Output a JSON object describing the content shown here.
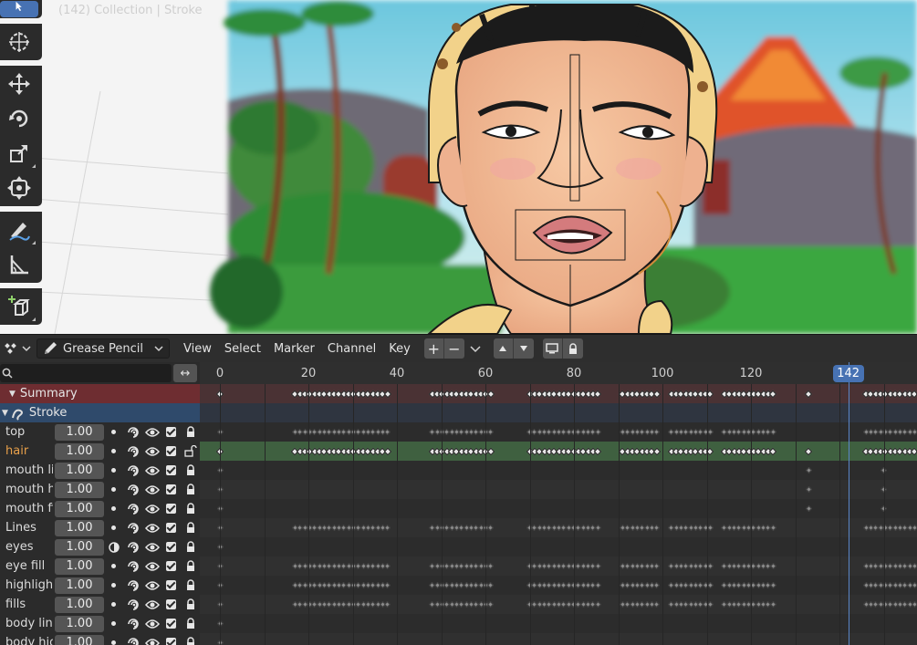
{
  "viewport": {
    "info": "(142) Collection | Stroke",
    "tools": [
      "select-box-icon",
      "cursor-icon",
      "move-icon",
      "rotate-icon",
      "scale-icon",
      "transform-icon",
      "annotate-icon",
      "measure-icon",
      "add-cube-icon"
    ]
  },
  "header": {
    "editor_type_icon": "dopesheet-icon",
    "mode": "Grease Pencil",
    "menus": [
      "View",
      "Select",
      "Marker",
      "Channel",
      "Key"
    ],
    "buttons": [
      "add-layer-icon",
      "remove-layer-icon",
      "chevron-down-icon",
      "move-up-icon",
      "move-down-icon",
      "monitor-icon",
      "lock-icon"
    ]
  },
  "channels": {
    "search_placeholder": "",
    "summary_label": "Summary",
    "object_label": "Stroke",
    "layers": [
      {
        "name": "top",
        "opacity": "1.00",
        "locked": true,
        "active": false
      },
      {
        "name": "hair",
        "opacity": "1.00",
        "locked": false,
        "active": true
      },
      {
        "name": "mouth lin",
        "opacity": "1.00",
        "locked": true,
        "active": false
      },
      {
        "name": "mouth hi",
        "opacity": "1.00",
        "locked": true,
        "active": false
      },
      {
        "name": "mouth fill",
        "opacity": "1.00",
        "locked": true,
        "active": false
      },
      {
        "name": "Lines",
        "opacity": "1.00",
        "locked": true,
        "active": false
      },
      {
        "name": "eyes",
        "opacity": "1.00",
        "locked": true,
        "active": false
      },
      {
        "name": "eye fill",
        "opacity": "1.00",
        "locked": true,
        "active": false
      },
      {
        "name": "highlight",
        "opacity": "1.00",
        "locked": true,
        "active": false
      },
      {
        "name": "fills",
        "opacity": "1.00",
        "locked": true,
        "active": false
      },
      {
        "name": "body line",
        "opacity": "1.00",
        "locked": true,
        "active": false
      },
      {
        "name": "body hig",
        "opacity": "1.00",
        "locked": true,
        "active": false
      }
    ]
  },
  "timeline": {
    "frame_labels": [
      "0",
      "20",
      "40",
      "60",
      "80",
      "100",
      "120"
    ],
    "current_frame": "142",
    "colors": {
      "summary": "#6e2d31",
      "object": "#2f4a6b",
      "active_layer": "#2f5a33",
      "accent": "#4772b3",
      "active_text": "#e8a04a"
    }
  }
}
